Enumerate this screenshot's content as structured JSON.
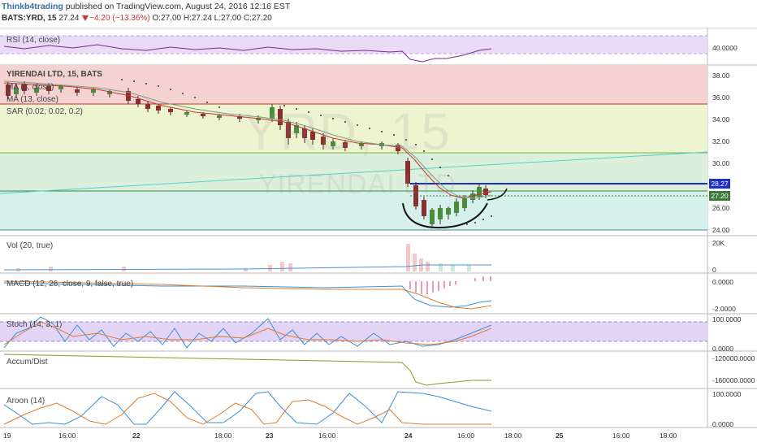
{
  "header": {
    "author": "Thinkb4trading",
    "published": "published on TradingView.com, August 24, 2016 12:16 EST",
    "symbol": "BATS:YRD, 15",
    "last": "27.24",
    "change": "−4.20 (−13.36%)",
    "open_label": "O:",
    "open": "27.00",
    "high_label": "H:",
    "high": "27.24",
    "low_label": "L:",
    "low": "27.00",
    "close_label": "C:",
    "close": "27.20"
  },
  "watermark": {
    "symbol": "YRD, 15",
    "name": "YIRENDAI LTD"
  },
  "panes": {
    "rsi": "RSI (14, close)",
    "main_title": "YIRENDAI LTD, 15, BATS",
    "ma8": "MA (8, close)",
    "ma13": "MA (13, close)",
    "sar": "SAR (0.02, 0.02, 0.2)",
    "vol": "Vol (20, true)",
    "macd": "MACD (12, 26, close, 9, false, true)",
    "stoch": "Stoch (14, 3, 1)",
    "accum": "Accum/Dist",
    "aroon": "Aroon (14)"
  },
  "axis": {
    "rsi": [
      "40.0000"
    ],
    "price": [
      "38.00",
      "36.00",
      "34.00",
      "32.00",
      "30.00",
      "26.00",
      "24.00"
    ],
    "vol": [
      "20K",
      "0"
    ],
    "macd": [
      "0.0000",
      "-2.0000"
    ],
    "stoch": [
      "100.0000",
      "0.0000"
    ],
    "accum": [
      "-120000.0000",
      "-160000.0000"
    ],
    "aroon": [
      "100.0000",
      "0.0000"
    ],
    "badge_resistance": "28.27",
    "badge_last": "27.20"
  },
  "xaxis": [
    "19",
    "16:00",
    "22",
    "18:00",
    "23",
    "16:00",
    "24",
    "16:00",
    "18:00",
    "25",
    "16:00",
    "18:00"
  ],
  "colors": {
    "up": "#4a8c3c",
    "down": "#8b2e2e",
    "ma8": "#c0392b",
    "ma13": "#7a9a8a",
    "badge_blue": "#1f2fbf",
    "badge_green": "#3c7a3c"
  }
}
